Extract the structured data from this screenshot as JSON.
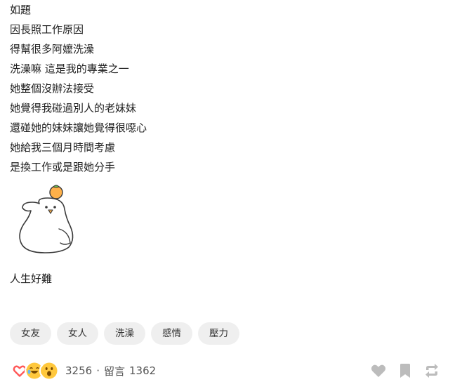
{
  "post": {
    "lines": [
      "如題",
      "因長照工作原因",
      "得幫很多阿嬤洗澡",
      "洗澡嘛 這是我的專業之一",
      "她整個沒辦法接受",
      "她覺得我碰過別人的老妹妹",
      "還碰她的妹妹讓她覺得很噁心",
      "她給我三個月時間考慮",
      "是換工作或是跟她分手"
    ],
    "closing": "人生好難"
  },
  "tags": [
    "女友",
    "女人",
    "洗澡",
    "感情",
    "壓力"
  ],
  "footer": {
    "reaction_count": "3256",
    "separator": "·",
    "comments_label": "留言",
    "comments_count": "1362"
  },
  "icons": {
    "reactions": [
      "heart-reaction-icon",
      "laugh-reaction-icon",
      "surprised-reaction-icon"
    ],
    "actions": [
      "like-heart-icon",
      "bookmark-icon",
      "share-icon"
    ]
  },
  "colors": {
    "heart": "#ff5757",
    "emoji_yellow": "#ffc83d",
    "tag_bg": "#efefef",
    "action_icon": "#bcbcbc"
  }
}
